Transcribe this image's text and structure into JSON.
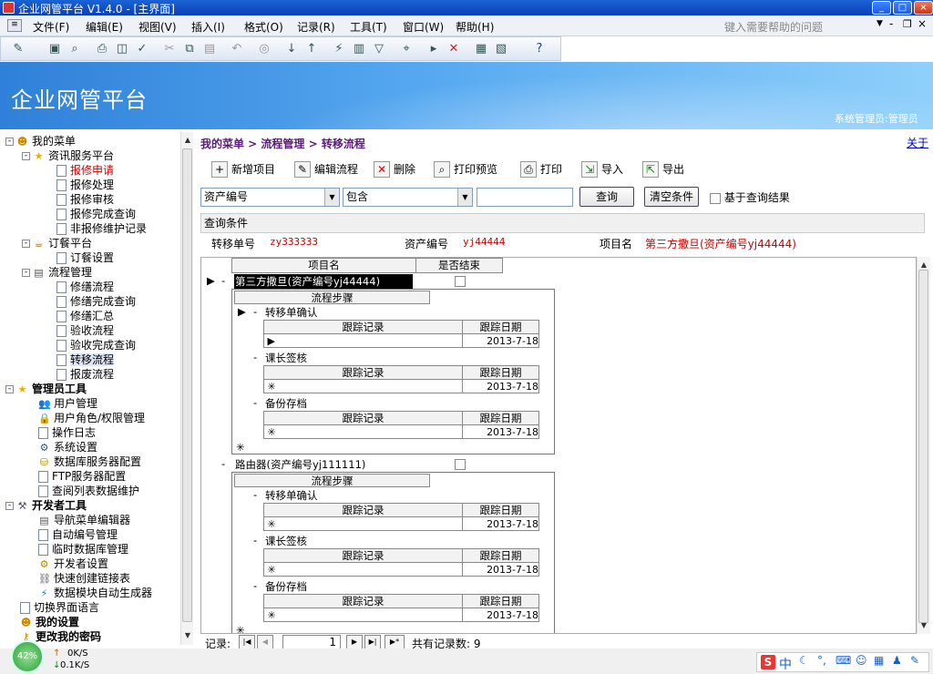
{
  "window": {
    "title": "企业网管平台  V1.4.0 - [主界面]"
  },
  "menus": [
    "文件(F)",
    "编辑(E)",
    "视图(V)",
    "插入(I)",
    "格式(O)",
    "记录(R)",
    "工具(T)",
    "窗口(W)",
    "帮助(H)"
  ],
  "help_placeholder": "键入需要帮助的问题",
  "banner": {
    "app_name": "企业网管平台",
    "user": "系统管理员:管理员"
  },
  "tree": {
    "root": "我的菜单",
    "groups": [
      {
        "label": "资讯服务平台",
        "items": [
          "报修申请",
          "报修处理",
          "报修审核",
          "报修完成查询",
          "非报修维护记录"
        ]
      },
      {
        "label": "订餐平台",
        "items": [
          "订餐设置"
        ]
      },
      {
        "label": "流程管理",
        "items": [
          "修缮流程",
          "修缮完成查询",
          "修缮汇总",
          "验收流程",
          "验收完成查询",
          "转移流程",
          "报废流程"
        ]
      }
    ],
    "admin": {
      "label": "管理员工具",
      "items": [
        "用户管理",
        "用户角色/权限管理",
        "操作日志",
        "系统设置",
        "数据库服务器配置",
        "FTP服务器配置",
        "查阅列表数据维护"
      ]
    },
    "dev": {
      "label": "开发者工具",
      "items": [
        "导航菜单编辑器",
        "自动编号管理",
        "临时数据库管理",
        "开发者设置",
        "快速创建链接表",
        "数据模块自动生成器"
      ]
    },
    "bottom": [
      "切换界面语言",
      "我的设置",
      "更改我的密码"
    ]
  },
  "breadcrumb": "我的菜单 > 流程管理 > 转移流程",
  "close_label": "关于",
  "buttons": {
    "add": "新增项目",
    "edit": "编辑流程",
    "delete": "删除",
    "preview": "打印预览",
    "print": "打印",
    "import": "导入",
    "export": "导出"
  },
  "query": {
    "field": "资产编号",
    "op": "包含",
    "value": "",
    "search": "查询",
    "clear": "清空条件",
    "base_on_result": "基于查询结果",
    "condition_label": "查询条件"
  },
  "detail": {
    "transfer_no_label": "转移单号",
    "transfer_no": "zy333333",
    "asset_no_label": "资产编号",
    "asset_no": "yj44444",
    "item_label": "项目名",
    "item_name": "第三方撒旦(资产编号yj44444)"
  },
  "grid": {
    "col_item": "项目名",
    "col_done": "是否结束",
    "col_step": "流程步骤",
    "col_record": "跟踪记录",
    "col_date": "跟踪日期",
    "rows": [
      {
        "name": "第三方撒旦(资产编号yj44444)",
        "steps": [
          {
            "name": "转移单确认",
            "date": "2013-7-18"
          },
          {
            "name": "课长签核",
            "date": "2013-7-18"
          },
          {
            "name": "备份存档",
            "date": "2013-7-18"
          }
        ]
      },
      {
        "name": "路由器(资产编号yj111111)",
        "steps": [
          {
            "name": "转移单确认",
            "date": "2013-7-18"
          },
          {
            "name": "课长签核",
            "date": "2013-7-18"
          },
          {
            "name": "备份存档",
            "date": "2013-7-18"
          }
        ]
      }
    ]
  },
  "nav": {
    "label": "记录:",
    "current": "1",
    "total_text": "共有记录数: 9"
  },
  "status": {
    "cpu": "42%",
    "up": "0K/S",
    "down": "0.1K/S"
  },
  "ime": {
    "label": "中"
  }
}
